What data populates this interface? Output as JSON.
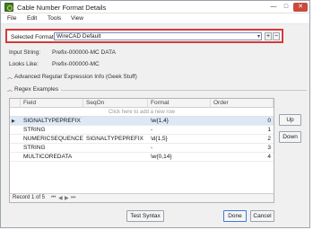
{
  "window": {
    "title": "Cable Number Format Details",
    "min_glyph": "—",
    "max_glyph": "□",
    "close_glyph": "✕"
  },
  "menu": [
    "File",
    "Edit",
    "Tools",
    "View"
  ],
  "format": {
    "label": "Selected Format:",
    "value": "WireCAD Default",
    "chevron": "▾",
    "add": "+",
    "remove": "−"
  },
  "input_string": {
    "label": "Input String:",
    "value": "Prefix-000000-MC DATA"
  },
  "looks_like": {
    "label": "Looks Like:",
    "value": "Prefix-000000-MC"
  },
  "sections": {
    "advanced": "Advanced Regular Expression Info (Geek Stuff)",
    "regex": "Regex Examples",
    "chevron": "︿"
  },
  "grid": {
    "columns": [
      "Field",
      "SeqOn",
      "Format",
      "Order"
    ],
    "new_row_hint": "Click here to add a new row",
    "rows": [
      {
        "field": "SIGNALTYPEPREFIX",
        "seqon": "",
        "format": "\\w{1,4}",
        "order": "0",
        "selected": true
      },
      {
        "field": "STRING",
        "seqon": "",
        "format": "-",
        "order": "1"
      },
      {
        "field": "NUMERICSEQUENCE",
        "seqon": "SIGNALTYPEPREFIX",
        "format": "\\d{1,5}",
        "order": "2"
      },
      {
        "field": "STRING",
        "seqon": "",
        "format": "-",
        "order": "3"
      },
      {
        "field": "MULTICOREDATA",
        "seqon": "",
        "format": "\\w{0,14}",
        "order": "4"
      }
    ],
    "record_text": "Record 1 of 5",
    "row_indicator": "▶",
    "nav": [
      "⏮",
      "◀",
      "▶",
      "⏭"
    ]
  },
  "buttons": {
    "up": "Up",
    "down": "Down",
    "test_syntax": "Test Syntax",
    "done": "Done",
    "cancel": "Cancel"
  }
}
